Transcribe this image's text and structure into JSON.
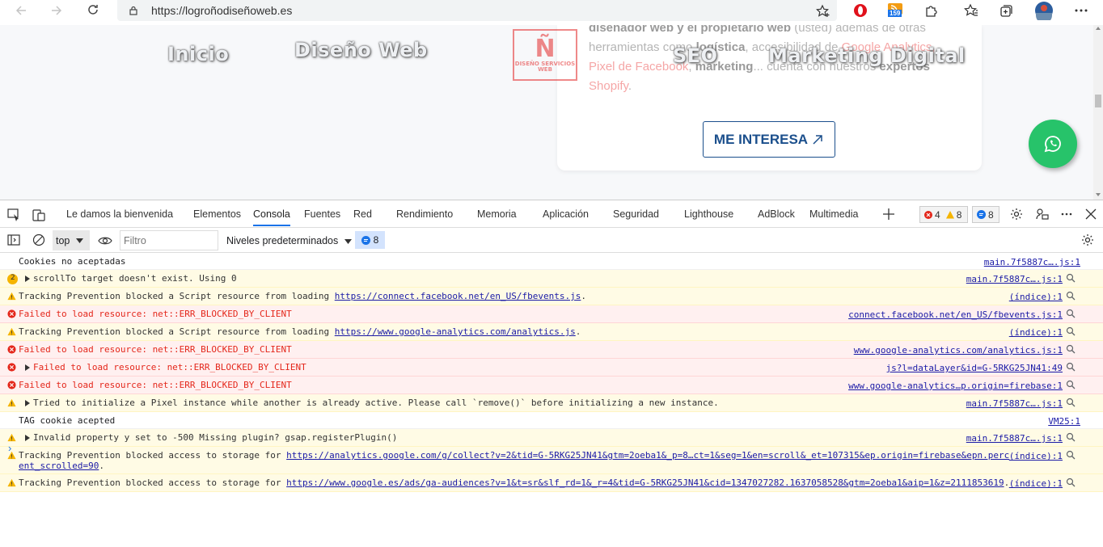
{
  "browser": {
    "url": "https://logroñodiseñoweb.es",
    "extension_badge": "159"
  },
  "page": {
    "nav": [
      "Inicio",
      "Diseño Web",
      "SEO",
      "Marketing Digital"
    ],
    "logo_text": "Ñ",
    "logo_sub": "DISEÑO SERVICIOS WEB",
    "card_line1_a": "diseñador web y el propietario web",
    "card_line1_b": " (usted) además de otras",
    "card_line2_a": "herramientas como ",
    "card_line2_b": "logística",
    "card_line2_c": ", accesibilidad de ",
    "card_line2_d": "Google Analytics,",
    "card_line3_a": "Pixel de Facebook",
    "card_line3_b": ", ",
    "card_line3_c": "marketing",
    "card_line3_d": "... cuenta con nuestros ",
    "card_line3_e": "expertos",
    "card_line4": "Shopify",
    "card_line4_end": ".",
    "cta_label": "ME INTERESA"
  },
  "devtools": {
    "tabs": [
      "Le damos la bienvenida",
      "Elementos",
      "Consola",
      "Fuentes",
      "Red",
      "Rendimiento",
      "Memoria",
      "Aplicación",
      "Seguridad",
      "Lighthouse",
      "AdBlock",
      "Multimedia"
    ],
    "error_count": "4",
    "warn_count": "8",
    "info_count": "8",
    "context": "top",
    "filter_placeholder": "Filtro",
    "levels": "Niveles predeterminados",
    "issues_count": "8"
  },
  "console": [
    {
      "type": "info",
      "msg": "Cookies no aceptadas",
      "src": "main.7f5887c….js:1",
      "zoom": false
    },
    {
      "type": "warn",
      "count": "2",
      "expand": true,
      "msg": "scrollTo target doesn't exist. Using 0",
      "src": "main.7f5887c….js:1",
      "zoom": true
    },
    {
      "type": "warn",
      "msg": "Tracking Prevention blocked a Script resource from loading ",
      "link": "https://connect.facebook.net/en_US/fbevents.js",
      "tail": ".",
      "src": "(índice):1",
      "zoom": true
    },
    {
      "type": "error",
      "msg": "Failed to load resource: net::ERR_BLOCKED_BY_CLIENT",
      "src": "connect.facebook.net/en_US/fbevents.js:1",
      "zoom": true
    },
    {
      "type": "warn",
      "msg": "Tracking Prevention blocked a Script resource from loading ",
      "link": "https://www.google-analytics.com/analytics.js",
      "tail": ".",
      "src": "(índice):1",
      "zoom": true
    },
    {
      "type": "error",
      "msg": "Failed to load resource: net::ERR_BLOCKED_BY_CLIENT",
      "src": "www.google-analytics.com/analytics.js:1",
      "zoom": true
    },
    {
      "type": "error",
      "expand": true,
      "msg": "Failed to load resource: net::ERR_BLOCKED_BY_CLIENT",
      "src": "js?l=dataLayer&id=G-5RKG25JN41:49",
      "zoom": true
    },
    {
      "type": "error",
      "msg": "Failed to load resource: net::ERR_BLOCKED_BY_CLIENT",
      "src": "www.google-analytics…p.origin=firebase:1",
      "zoom": true
    },
    {
      "type": "warn",
      "expand": true,
      "msg": "Tried to initialize a Pixel instance while another is already active. Please call `remove()` before initializing a new instance.",
      "src": "main.7f5887c….js:1",
      "zoom": true
    },
    {
      "type": "info",
      "msg": "TAG cookie acepted",
      "src": "VM25:1",
      "zoom": false
    },
    {
      "type": "warn",
      "expand": true,
      "msg": "Invalid property y set to -500 Missing plugin? gsap.registerPlugin()",
      "src": "main.7f5887c….js:1",
      "zoom": true
    },
    {
      "type": "warn",
      "msg": "Tracking Prevention blocked access to storage for ",
      "link": "https://analytics.google.com/g/collect?v=2&tid=G-5RKG25JN41&gtm=2oeba1&_p=8…ct=1&seg=1&en=scroll&_et=107315&ep.origin=firebase&epn.perc",
      "line2": "ent_scrolled=90",
      "tail": ".",
      "src": "(índice):1",
      "zoom": true
    },
    {
      "type": "warn",
      "msg": "Tracking Prevention blocked access to storage for ",
      "link": "https://www.google.es/ads/ga-audiences?v=1&t=sr&slf_rd=1&_r=4&tid=G-5RKG25JN41&cid=1347027282.1637058528&gtm=2oeba1&aip=1&z=2111853619",
      "tail": ".",
      "src": "(índice):1",
      "zoom": true
    }
  ],
  "prompt_symbol": "›"
}
